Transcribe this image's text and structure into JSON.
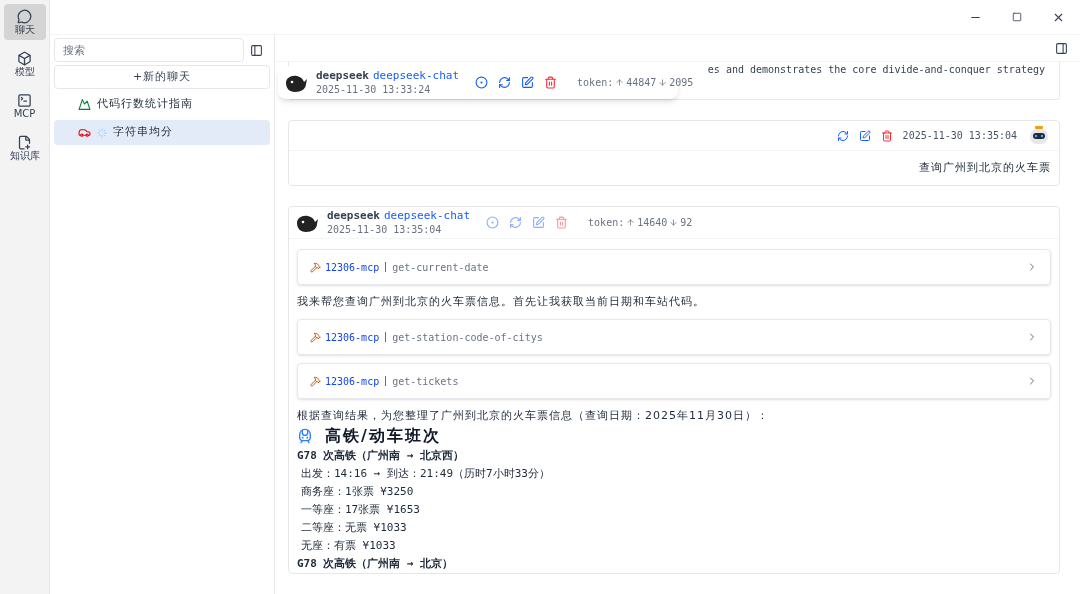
{
  "rail": [
    {
      "kind": "chat",
      "label": "聊天",
      "selected": true
    },
    {
      "kind": "model",
      "label": "模型",
      "selected": false
    },
    {
      "kind": "mcp",
      "label": "MCP",
      "selected": false
    },
    {
      "kind": "knowledge",
      "label": "知识库",
      "selected": false
    }
  ],
  "sidebar": {
    "search": {
      "placeholder": "搜索"
    },
    "new_chat": "+新的聊天",
    "chats": [
      {
        "kind": "landscape",
        "title": "代码行数统计指南",
        "selected": false,
        "loading": false
      },
      {
        "kind": "car",
        "title": "字符串均分",
        "selected": true,
        "loading": true
      }
    ]
  },
  "previous_message": {
    "text": "es and demonstrates the core divide-and-conquer strategy",
    "header": {
      "provider": "deepseek",
      "model": "deepseek-chat",
      "time": "2025-11-30 13:33:24",
      "token_label": "token:",
      "tokens_up": "44847",
      "tokens_down": "2095"
    }
  },
  "user_message": {
    "time": "2025-11-30 13:35:04",
    "text": "查询广州到北京的火车票"
  },
  "assistant_message": {
    "provider": "deepseek",
    "model": "deepseek-chat",
    "time": "2025-11-30 13:35:04",
    "token_label": "token:",
    "tokens_up": "14640",
    "tokens_down": "92",
    "blocks": [
      {
        "kind": "tool",
        "server": "12306-mcp",
        "tool": "get-current-date"
      },
      {
        "kind": "paragraph",
        "text": "我来帮您查询广州到北京的火车票信息。首先让我获取当前日期和车站代码。"
      },
      {
        "kind": "tool",
        "server": "12306-mcp",
        "tool": "get-station-code-of-citys"
      },
      {
        "kind": "tool",
        "server": "12306-mcp",
        "tool": "get-tickets"
      },
      {
        "kind": "paragraph",
        "text": "根据查询结果，为您整理了广州到北京的火车票信息（查询日期：2025年11月30日）："
      },
      {
        "kind": "heading",
        "text": "高铁/动车班次"
      },
      {
        "kind": "title",
        "text": "G78 次高铁（广州南 → 北京西）"
      },
      {
        "kind": "detail",
        "text": "出发：14:16 → 到达：21:49（历时7小时33分）"
      },
      {
        "kind": "detail",
        "text": "商务座：1张票 ¥3250"
      },
      {
        "kind": "detail",
        "text": "一等座：17张票 ¥1653"
      },
      {
        "kind": "detail",
        "text": "二等座：无票 ¥1033"
      },
      {
        "kind": "detail",
        "text": "无座：有票 ¥1033"
      },
      {
        "kind": "title",
        "text": "G78 次高铁（广州南 → 北京）"
      }
    ]
  }
}
